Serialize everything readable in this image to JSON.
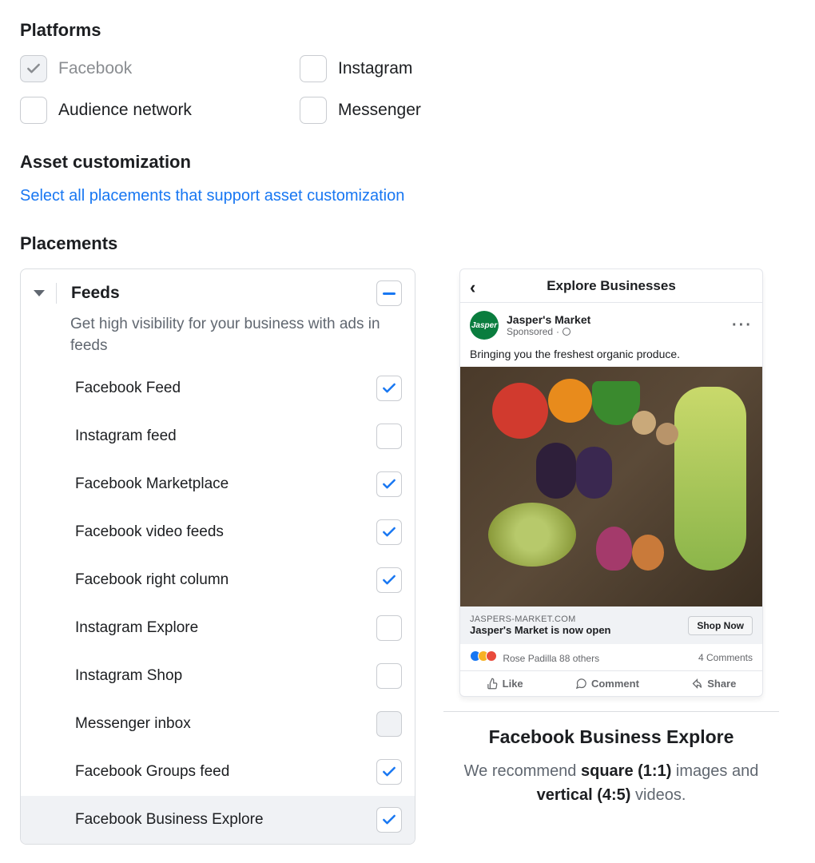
{
  "platforms": {
    "heading": "Platforms",
    "items": [
      {
        "label": "Facebook",
        "checked": true,
        "disabled": true
      },
      {
        "label": "Instagram",
        "checked": false,
        "disabled": false
      },
      {
        "label": "Audience network",
        "checked": false,
        "disabled": false
      },
      {
        "label": "Messenger",
        "checked": false,
        "disabled": false
      }
    ]
  },
  "asset": {
    "heading": "Asset customization",
    "link": "Select all placements that support asset customization"
  },
  "placements": {
    "heading": "Placements",
    "group_title": "Feeds",
    "group_desc": "Get high visibility for your business with ads in feeds",
    "indeterminate": true,
    "rows": [
      {
        "label": "Facebook Feed",
        "checked": true,
        "disabled": false,
        "selected": false
      },
      {
        "label": "Instagram feed",
        "checked": false,
        "disabled": false,
        "selected": false
      },
      {
        "label": "Facebook Marketplace",
        "checked": true,
        "disabled": false,
        "selected": false
      },
      {
        "label": "Facebook video feeds",
        "checked": true,
        "disabled": false,
        "selected": false
      },
      {
        "label": "Facebook right column",
        "checked": true,
        "disabled": false,
        "selected": false
      },
      {
        "label": "Instagram Explore",
        "checked": false,
        "disabled": false,
        "selected": false
      },
      {
        "label": "Instagram Shop",
        "checked": false,
        "disabled": false,
        "selected": false
      },
      {
        "label": "Messenger inbox",
        "checked": false,
        "disabled": true,
        "selected": false
      },
      {
        "label": "Facebook Groups feed",
        "checked": true,
        "disabled": false,
        "selected": false
      },
      {
        "label": "Facebook Business Explore",
        "checked": true,
        "disabled": false,
        "selected": true
      }
    ]
  },
  "preview": {
    "phone_title": "Explore Businesses",
    "brand": "Jasper's Market",
    "sponsored": "Sponsored",
    "caption": "Bringing you the freshest organic produce.",
    "domain": "JASPERS-MARKET.COM",
    "headline": "Jasper's Market is now open",
    "cta": "Shop Now",
    "reactions_text": "Rose Padilla 88 others",
    "comments": "4 Comments",
    "like": "Like",
    "comment": "Comment",
    "share": "Share",
    "title": "Facebook Business Explore",
    "reco_pre": "We recommend ",
    "reco_b1": "square (1:1)",
    "reco_mid": " images and ",
    "reco_b2": "vertical (4:5)",
    "reco_post": " videos."
  }
}
